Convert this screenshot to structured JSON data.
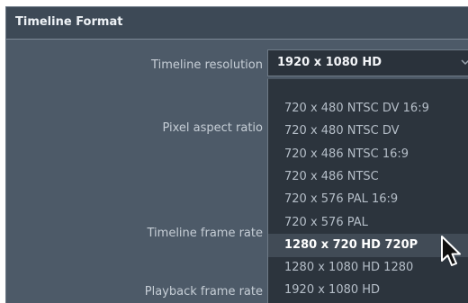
{
  "panel": {
    "title": "Timeline Format"
  },
  "fields": {
    "timeline_resolution": "Timeline resolution",
    "pixel_aspect_ratio": "Pixel aspect ratio",
    "timeline_frame_rate": "Timeline frame rate",
    "playback_frame_rate": "Playback frame rate"
  },
  "resolution_select": {
    "value": "1920 x 1080 HD",
    "icon": "chevron-down-icon"
  },
  "dropdown": {
    "options": [
      "720 x 480 NTSC DV 16:9",
      "720 x 480 NTSC DV",
      "720 x 486 NTSC 16:9",
      "720 x 486 NTSC",
      "720 x 576 PAL 16:9",
      "720 x 576 PAL",
      "1280 x 720 HD 720P",
      "1280 x 1080 HD 1280",
      "1920 x 1080 HD"
    ],
    "highlighted": "1280 x 720 HD 720P"
  },
  "pointer": {
    "icon": "mouse-cursor-icon"
  },
  "colors": {
    "panel_bg": "#4d5a68",
    "header_bg": "#3d4956",
    "dropdown_bg": "#2c343d",
    "highlight_bg": "#414b56"
  }
}
